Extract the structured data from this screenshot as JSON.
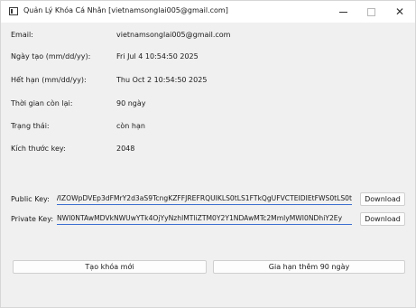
{
  "window": {
    "title": "Quản Lý Khóa Cá Nhân [vietnamsonglai005@gmail.com]",
    "minimize_glyph": "–",
    "close_glyph": "✕"
  },
  "info": {
    "email_label": "Email:",
    "email_value": "vietnamsonglai005@gmail.com",
    "created_label": "Ngày tạo (mm/dd/yy):",
    "created_value": "Fri Jul  4 10:54:50 2025",
    "expires_label": "Hết hạn (mm/dd/yy):",
    "expires_value": "Thu Oct  2 10:54:50 2025",
    "remaining_label": "Thời gian còn lại:",
    "remaining_value": "90 ngày",
    "status_label": "Trạng thái:",
    "status_value": "còn hạn",
    "keysize_label": "Kích thước key:",
    "keysize_value": "2048"
  },
  "keys": {
    "public_label": "Public Key:",
    "public_value": "aVIZOWpDVEp3dFMrY2d3aS9TcngKZFFJREFRQUIKLS0tLS1FTkQgUFVCTEIDIEtFWS0tLS0t",
    "private_label": "Private Key:",
    "private_value": "NWI0NTAwMDVkNWUwYTk4OjYyNzhlMTliZTM0Y2Y1NDAwMTc2MmlyMWI0NDhiY2Ey",
    "download_label": "Download"
  },
  "actions": {
    "new_key_label": "Tạo khóa mới",
    "extend_label": "Gia hạn thêm 90 ngày"
  }
}
